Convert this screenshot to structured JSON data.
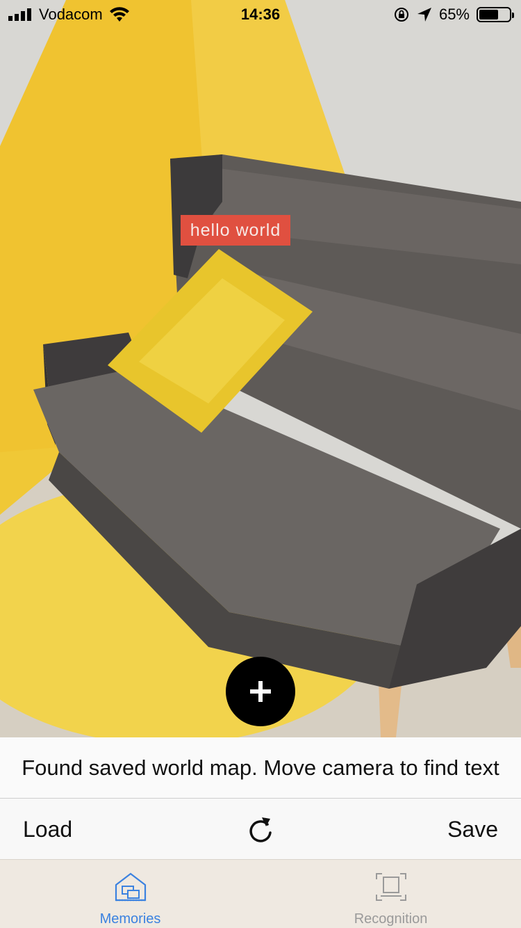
{
  "status_bar": {
    "carrier": "Vodacom",
    "time": "14:36",
    "battery_percent": "65%",
    "battery_level": 0.65,
    "icons": [
      "signal-icon",
      "wifi-icon",
      "orientation-lock-icon",
      "location-arrow-icon",
      "battery-icon"
    ]
  },
  "ar_view": {
    "label_text": "hello world",
    "label_color": "#e05040",
    "add_button_icon": "plus-icon"
  },
  "message": {
    "text": "Found saved world map. Move camera to find text"
  },
  "toolbar": {
    "load_label": "Load",
    "reload_icon": "reload-icon",
    "save_label": "Save"
  },
  "tab_bar": {
    "tabs": [
      {
        "label": "Memories",
        "icon": "memories-house-icon",
        "selected": true
      },
      {
        "label": "Recognition",
        "icon": "recognition-frame-icon",
        "selected": false
      }
    ],
    "accent_color": "#3b82e0"
  }
}
